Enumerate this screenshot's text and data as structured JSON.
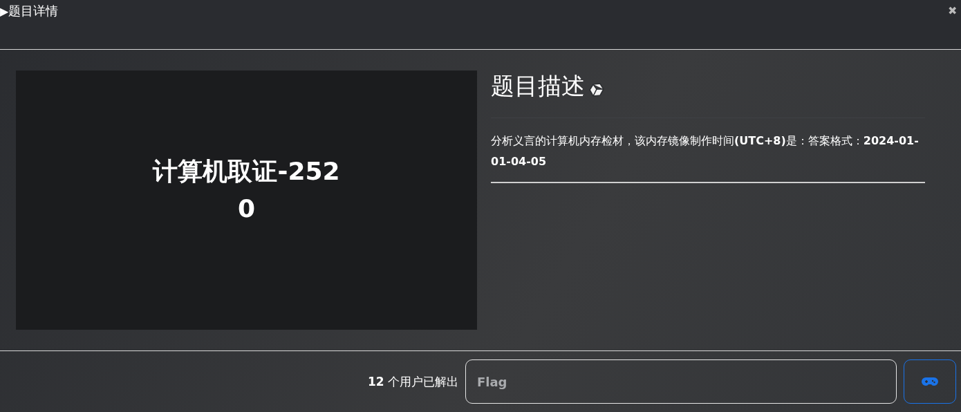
{
  "window": {
    "title": "题目详情",
    "play_marker": "▶",
    "close": "✖"
  },
  "challenge": {
    "card_title": "计算机取证-2520",
    "heading": "题目描述",
    "description": "分析义言的计算机内存检材，该内存镜像制作时间**(UTC+8)**是：答案格式：**2024-01-01-04-05**"
  },
  "footer": {
    "solved_count": "12",
    "solved_label": "个用户已解出",
    "flag_field": {
      "placeholder": "Flag"
    }
  }
}
